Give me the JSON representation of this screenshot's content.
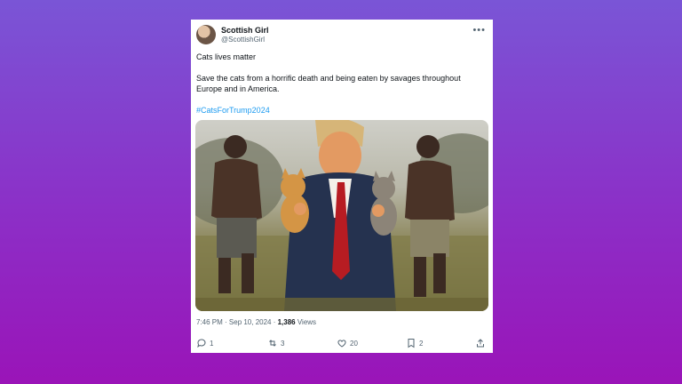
{
  "post": {
    "author_name": "Scottish Girl",
    "author_handle": "@ScottishGirl",
    "line1": "Cats lives matter",
    "line2": "Save the cats  from a horrific death and being eaten by savages throughout Europe and in America.",
    "hashtag": "#CatsForTrump2024",
    "time": "7:46 PM · Sep 10, 2024 · ",
    "views_count": "1,386",
    "views_label": " Views"
  },
  "actions": {
    "replies": "1",
    "reposts": "3",
    "likes": "20",
    "bookmarks": "2"
  },
  "colors": {
    "hashtag": "#1d9bf0",
    "secondary_text": "#536471",
    "background_top": "#7a55d6",
    "background_bottom": "#9a14b8"
  },
  "icons": [
    "more-icon",
    "reply-icon",
    "repost-icon",
    "like-icon",
    "bookmark-icon",
    "share-icon"
  ]
}
